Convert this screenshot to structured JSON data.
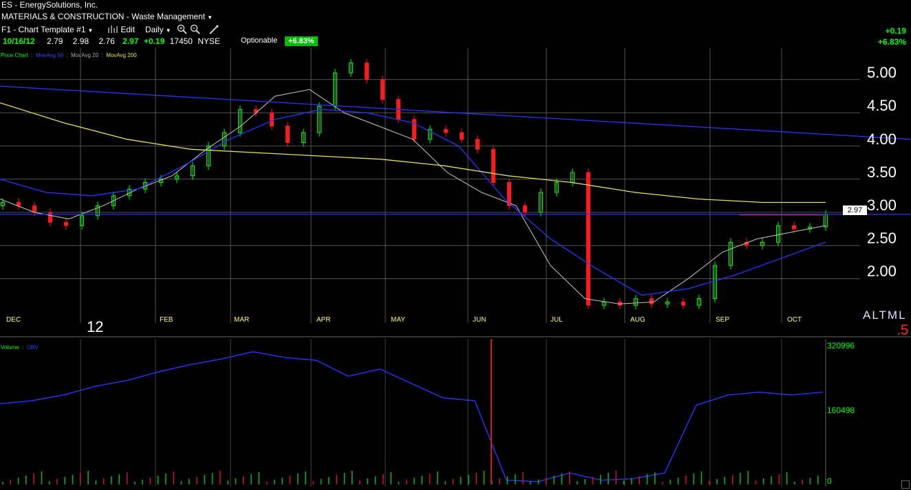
{
  "header": {
    "title": "ES - EnergySolutions, Inc.",
    "sector": "MATERIALS & CONSTRUCTION - Waste Management",
    "template": "F1 - Chart Template #1",
    "edit_label": "Edit",
    "period": "Daily"
  },
  "quote": {
    "date": "10/16/12",
    "open": "2.79",
    "high": "2.98",
    "low": "2.76",
    "close": "2.97",
    "change": "+0.19",
    "volume": "17450",
    "exchange": "NYSE",
    "optionable": "Optionable",
    "pct_badge": "+6.83%",
    "change_right": "+0.19",
    "pct_right": "+6.83%"
  },
  "legend": {
    "price_chart": "Price Chart",
    "sep": ":",
    "mov50": "MovAvg 50",
    "mov20": "MovAvg 20",
    "mov200": "MovAvg 200",
    "volume": "Volume",
    "obv": "OBV"
  },
  "price_tag": "2.97",
  "year_label": "12",
  "altml": "ALTML",
  "corner_num": ".5",
  "chart_data": [
    {
      "type": "line",
      "panel": "price",
      "ylim": [
        1.5,
        5.4
      ],
      "y_ticks": [
        "5.00",
        "4.50",
        "4.00",
        "3.50",
        "3.00",
        "2.50",
        "2.00"
      ],
      "x_labels": [
        "DEC",
        "FEB",
        "MAR",
        "APR",
        "MAY",
        "JUN",
        "JUL",
        "AUG",
        "SEP",
        "OCT"
      ],
      "series": [
        {
          "name": "Price Chart",
          "style": "candlestick",
          "values": [
            3.15,
            3.1,
            3.0,
            2.85,
            2.8,
            2.95,
            3.1,
            3.25,
            3.35,
            3.45,
            3.5,
            3.55,
            3.7,
            4.0,
            4.2,
            4.55,
            4.5,
            4.3,
            4.05,
            4.2,
            4.6,
            5.1,
            5.25,
            5.0,
            4.7,
            4.4,
            4.1,
            4.25,
            4.2,
            4.1,
            3.95,
            3.45,
            3.1,
            3.0,
            3.3,
            3.45,
            3.6,
            1.6,
            1.65,
            1.6,
            1.7,
            1.62,
            1.65,
            1.6,
            1.7,
            2.2,
            2.55,
            2.5,
            2.55,
            2.8,
            2.75,
            2.78,
            2.97
          ]
        },
        {
          "name": "MovAvg 20",
          "values": [
            3.2,
            3.0,
            2.9,
            3.1,
            3.35,
            3.55,
            3.95,
            4.3,
            4.75,
            4.85,
            4.5,
            4.3,
            4.1,
            3.6,
            3.3,
            3.1,
            2.2,
            1.7,
            1.62,
            1.65,
            2.0,
            2.4,
            2.6,
            2.7,
            2.8
          ]
        },
        {
          "name": "MovAvg 50",
          "values": [
            3.5,
            3.3,
            3.25,
            3.35,
            3.7,
            4.1,
            4.4,
            4.55,
            4.5,
            4.35,
            4.0,
            3.2,
            2.6,
            2.15,
            1.75,
            1.85,
            2.05,
            2.3,
            2.55
          ]
        },
        {
          "name": "MovAvg 200",
          "values": [
            4.65,
            4.35,
            4.1,
            3.95,
            3.9,
            3.85,
            3.8,
            3.7,
            3.55,
            3.45,
            3.3,
            3.2,
            3.15,
            3.15
          ]
        },
        {
          "name": "Trend line",
          "values": [
            4.9,
            4.1
          ]
        },
        {
          "name": "Horizontal line",
          "values": [
            2.97,
            2.97
          ]
        }
      ],
      "colors": {
        "up": "#00ff00",
        "down": "#ff1a1a",
        "mov20": "#c8c8c8",
        "mov50": "#2b35ff",
        "mov200": "#e6e64a"
      }
    },
    {
      "type": "line",
      "panel": "volume",
      "y_ticks": [
        "320996",
        "160498",
        "0"
      ],
      "series": [
        {
          "name": "OBV",
          "values": [
            56,
            58,
            62,
            68,
            72,
            78,
            83,
            87,
            92,
            88,
            86,
            75,
            80,
            70,
            60,
            58,
            3,
            2,
            8,
            3,
            4,
            8,
            55,
            62,
            64,
            62,
            64
          ]
        }
      ]
    }
  ]
}
